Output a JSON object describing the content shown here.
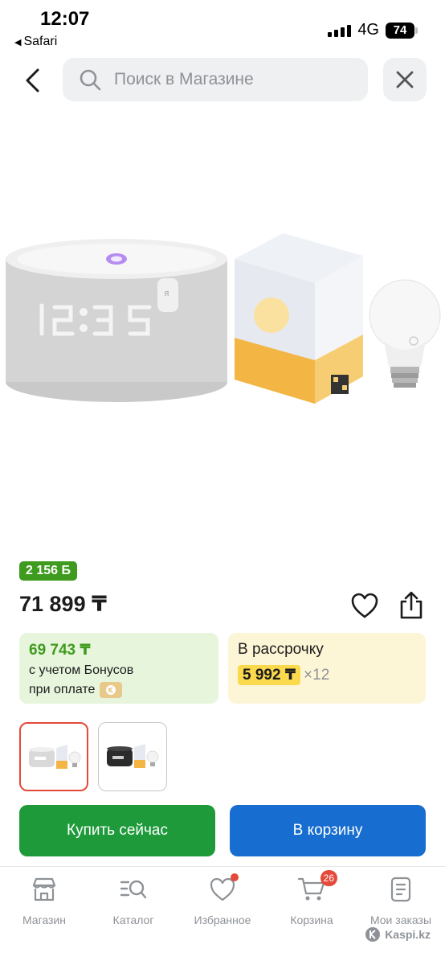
{
  "status_bar": {
    "time": "12:07",
    "back_app": "Safari",
    "network": "4G",
    "battery": "74"
  },
  "search": {
    "placeholder": "Поиск в Магазине"
  },
  "product": {
    "bonus": "2 156 Б",
    "price": "71 899 ₸",
    "display_time": "12:35"
  },
  "bonus_card": {
    "amount": "69 743 ₸",
    "line1": "с учетом Бонусов",
    "line2": "при оплате"
  },
  "installment_card": {
    "title": "В рассрочку",
    "amount": "5 992 ₸",
    "multiplier": "×12"
  },
  "actions": {
    "buy_now": "Купить сейчас",
    "add_to_cart": "В корзину"
  },
  "tabbar": {
    "items": [
      {
        "label": "Магазин",
        "icon": "store-icon"
      },
      {
        "label": "Каталог",
        "icon": "catalog-icon"
      },
      {
        "label": "Избранное",
        "icon": "heart-icon"
      },
      {
        "label": "Корзина",
        "icon": "cart-icon",
        "badge": "26"
      },
      {
        "label": "Мои заказы",
        "icon": "orders-icon"
      }
    ]
  },
  "watermark": "Kaspi.kz",
  "colors": {
    "green": "#3e9b1d",
    "buy_button": "#1e9a3b",
    "cart_button": "#176ed0",
    "badge_red": "#e5493a",
    "installment_yellow": "#fbd94c"
  }
}
